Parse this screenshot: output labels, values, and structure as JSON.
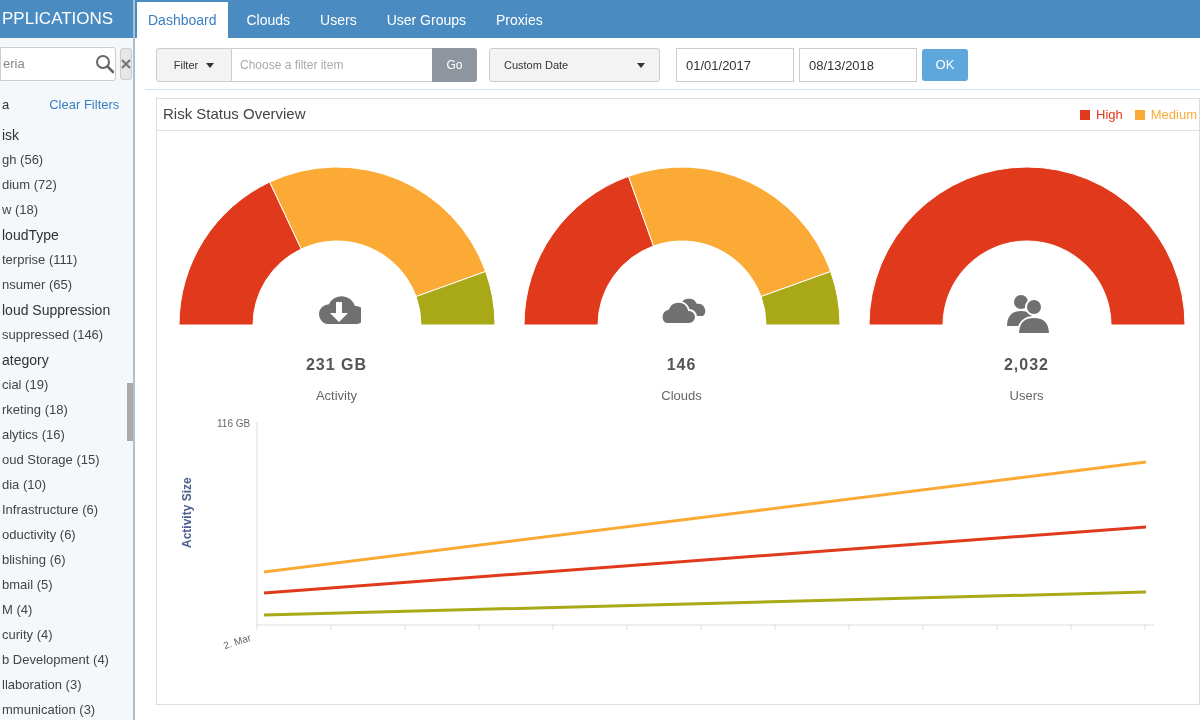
{
  "sidebar": {
    "title": "PPLICATIONS",
    "search": {
      "placeholder": "eria"
    },
    "criteria_label": "a",
    "clear_filters": "Clear Filters",
    "groups": [
      {
        "label": "isk",
        "children": [
          {
            "label": "gh (56)"
          },
          {
            "label": "dium (72)"
          },
          {
            "label": "w (18)"
          }
        ]
      },
      {
        "label": "loudType",
        "children": [
          {
            "label": "terprise (111)"
          },
          {
            "label": "nsumer (65)"
          }
        ]
      },
      {
        "label": "loud Suppression",
        "children": [
          {
            "label": "suppressed (146)"
          }
        ]
      },
      {
        "label": "ategory",
        "children": [
          {
            "label": "cial (19)"
          },
          {
            "label": "rketing (18)"
          },
          {
            "label": "alytics (16)"
          },
          {
            "label": "oud Storage (15)"
          },
          {
            "label": "dia (10)"
          },
          {
            "label": "Infrastructure (6)"
          },
          {
            "label": "oductivity (6)"
          },
          {
            "label": "blishing (6)"
          },
          {
            "label": "bmail (5)"
          },
          {
            "label": "M (4)"
          },
          {
            "label": "curity (4)"
          },
          {
            "label": "b Development (4)"
          },
          {
            "label": "llaboration (3)"
          },
          {
            "label": "mmunication (3)"
          }
        ]
      }
    ]
  },
  "tabs": [
    {
      "label": "Dashboard",
      "selected": true
    },
    {
      "label": "Clouds",
      "selected": false
    },
    {
      "label": "Users",
      "selected": false
    },
    {
      "label": "User Groups",
      "selected": false
    },
    {
      "label": "Proxies",
      "selected": false
    }
  ],
  "toolbar": {
    "filter": "Filter",
    "filter_placeholder": "Choose a filter item",
    "go": "Go",
    "date_range": "Custom Date",
    "from": "01/01/2017",
    "to": "08/13/2018",
    "ok": "OK"
  },
  "panel": {
    "title": "Risk Status Overview",
    "legend": [
      {
        "label": "High",
        "color": "#e0391b"
      },
      {
        "label": "Medium",
        "color": "#fbab35"
      }
    ],
    "gauges": [
      {
        "kind": "activity",
        "value": "231 GB",
        "label": "Activity"
      },
      {
        "kind": "clouds",
        "value": "146",
        "label": "Clouds"
      },
      {
        "kind": "users",
        "value": "2,032",
        "label": "Users"
      }
    ],
    "line_chart": {
      "y_top_label": "116 GB",
      "ylabel": "Activity Size",
      "x_first_label": "2. Mar"
    }
  }
}
